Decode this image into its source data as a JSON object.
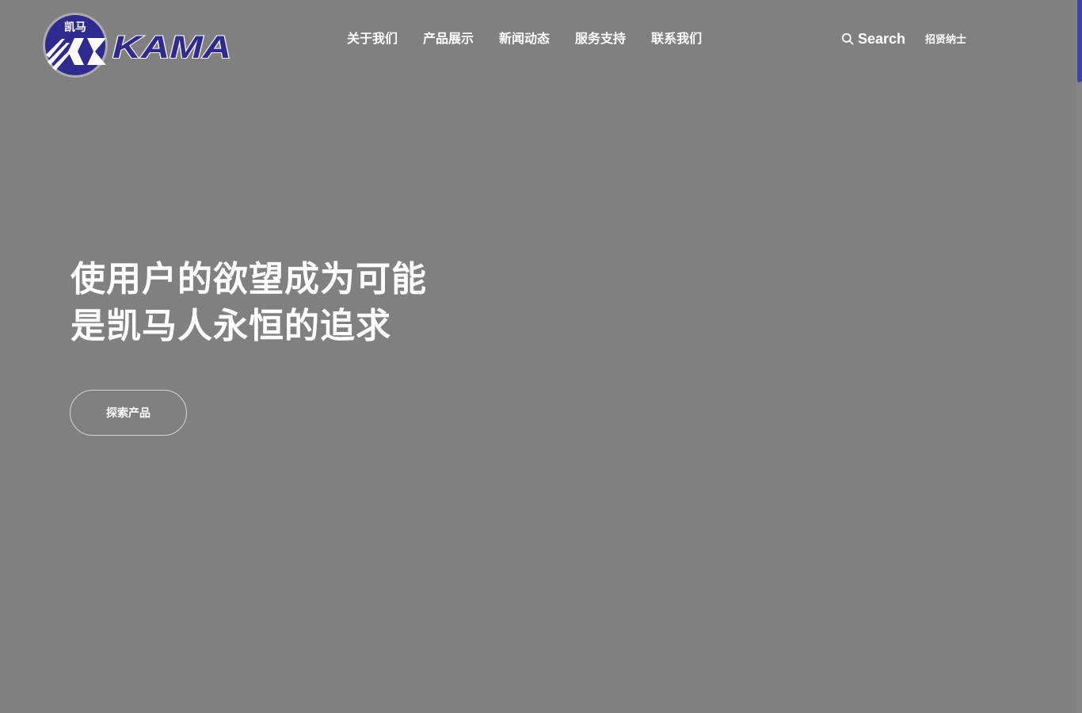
{
  "header": {
    "logo": {
      "emblem_text": "凯马",
      "wordmark": "KAMA",
      "colors": {
        "primary": "#2e2a8f",
        "accent": "#ffffff"
      }
    },
    "nav": [
      {
        "label": "关于我们"
      },
      {
        "label": "产品展示"
      },
      {
        "label": "新闻动态"
      },
      {
        "label": "服务支持"
      },
      {
        "label": "联系我们"
      }
    ],
    "search": {
      "icon": "search-icon",
      "label": "Search"
    },
    "recruit_label": "招贤纳士"
  },
  "hero": {
    "title_lines": [
      "使用户的欲望成为可能",
      "是凯马人永恒的追求"
    ],
    "cta_label": "探索产品"
  },
  "theme": {
    "background": "#808080",
    "text": "#ffffff",
    "scrollbar_thumb": "#3d44a8"
  }
}
